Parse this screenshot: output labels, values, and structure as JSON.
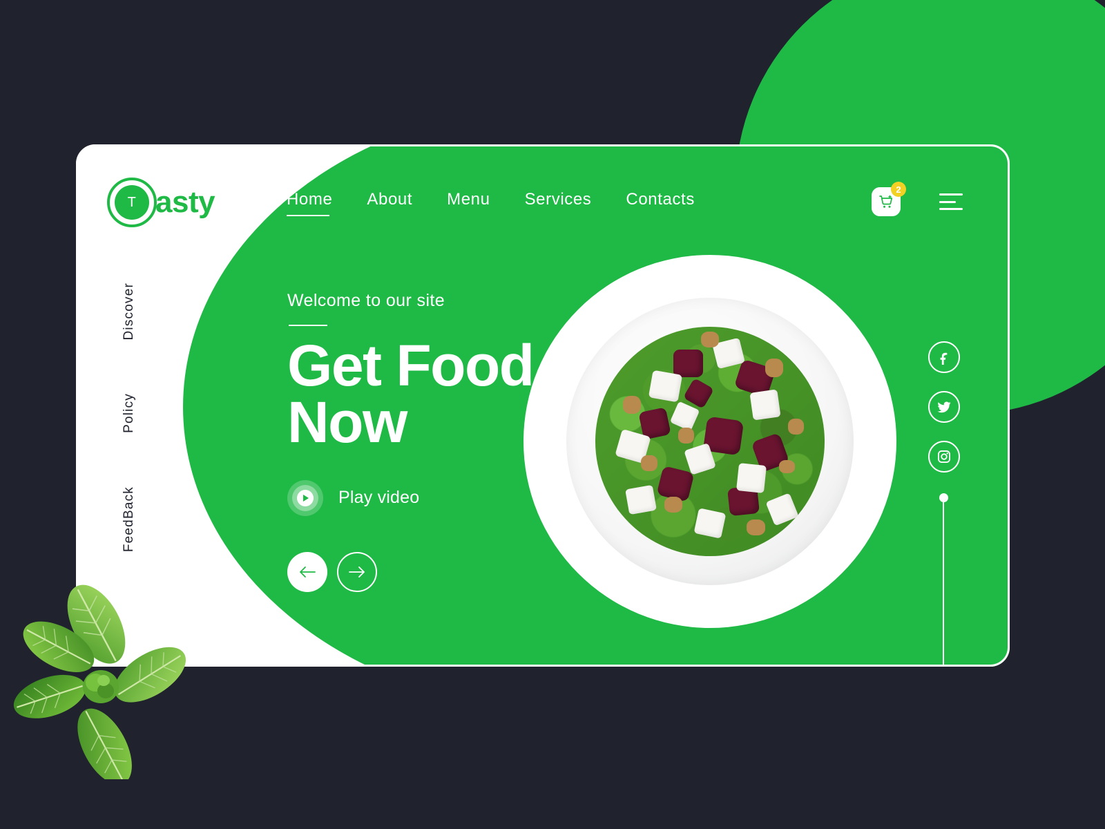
{
  "theme": {
    "brand_green": "#1FB946",
    "dark_bg": "#20232E",
    "white": "#FFFFFF",
    "badge_yellow": "#F2D024"
  },
  "header": {
    "logo": {
      "mark_letter": "T",
      "text": "asty"
    },
    "nav_items": [
      {
        "label": "Home",
        "active": true
      },
      {
        "label": "About",
        "active": false
      },
      {
        "label": "Menu",
        "active": false
      },
      {
        "label": "Services",
        "active": false
      },
      {
        "label": "Contacts",
        "active": false
      }
    ],
    "cart": {
      "icon": "shopping-cart-icon",
      "badge_count": "2"
    },
    "menu_toggle": {
      "icon": "hamburger-menu-icon"
    }
  },
  "left_rail": {
    "items": [
      {
        "label": "Discover"
      },
      {
        "label": "Policy"
      },
      {
        "label": "FeedBack"
      }
    ]
  },
  "hero": {
    "eyebrow": "Welcome to our site",
    "title_line1": "Get Food",
    "title_line2": "Now",
    "play": {
      "label": "Play video",
      "icon": "play-icon"
    },
    "carousel": {
      "prev_icon": "arrow-left-icon",
      "next_icon": "arrow-right-icon"
    }
  },
  "dish": {
    "alt": "beetroot feta arugula walnut salad in white bowl"
  },
  "social": {
    "items": [
      {
        "name": "facebook",
        "icon": "facebook-icon"
      },
      {
        "name": "twitter",
        "icon": "twitter-icon"
      },
      {
        "name": "instagram",
        "icon": "instagram-icon"
      }
    ]
  },
  "decor": {
    "mint_leaves": "mint-leaves-image",
    "background_circle": "green-circle-decoration"
  }
}
